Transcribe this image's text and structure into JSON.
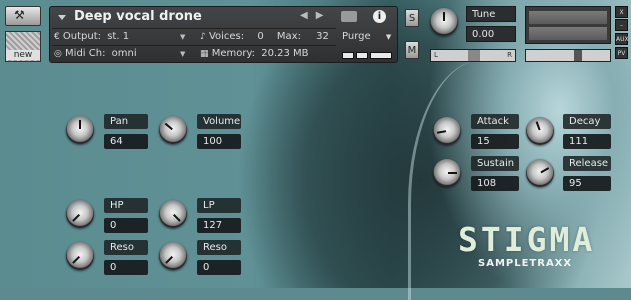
{
  "header": {
    "instrument_name": "Deep vocal drone",
    "new_label": "new",
    "output_label": "Output:",
    "output_value": "st. 1",
    "voices_label": "Voices:",
    "voices_value": "0",
    "max_label": "Max:",
    "max_value": "32",
    "purge_label": "Purge",
    "midi_label": "Midi Ch:",
    "midi_value": "omni",
    "memory_label": "Memory:",
    "memory_value": "20.23 MB",
    "solo_label": "S",
    "mute_label": "M",
    "tune_label": "Tune",
    "tune_value": "0.00",
    "pan_left": "L",
    "pan_right": "R",
    "aux_label": "AUX",
    "pv_label": "PV",
    "close_label": "X",
    "min_label": "–"
  },
  "params": {
    "pan": {
      "label": "Pan",
      "value": "64"
    },
    "volume": {
      "label": "Volume",
      "value": "100"
    },
    "hp": {
      "label": "HP",
      "value": "0"
    },
    "lp": {
      "label": "LP",
      "value": "127"
    },
    "reso1": {
      "label": "Reso",
      "value": "0"
    },
    "reso2": {
      "label": "Reso",
      "value": "0"
    },
    "attack": {
      "label": "Attack",
      "value": "15"
    },
    "decay": {
      "label": "Decay",
      "value": "111"
    },
    "sustain": {
      "label": "Sustain",
      "value": "108"
    },
    "release": {
      "label": "Release",
      "value": "95"
    }
  },
  "brand": {
    "title": "STIGMA",
    "subtitle": "SAMPLETRAXX"
  },
  "colors": {
    "label_bg": "#1e2426",
    "accent": "#dfeeda"
  }
}
